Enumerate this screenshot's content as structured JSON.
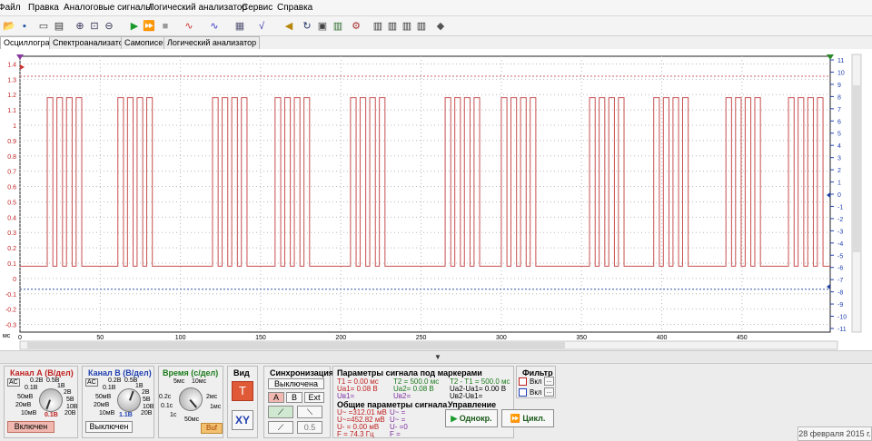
{
  "menu": [
    "Файл",
    "Правка",
    "Аналоговые сигналы",
    "Логический анализатор",
    "Сервис",
    "Справка"
  ],
  "tabs": [
    "Осциллограф",
    "Спектроанализатор",
    "Самописец",
    "Логический анализатор"
  ],
  "toolbar_icons": [
    "open-icon",
    "save-icon",
    "preview-icon",
    "print-icon",
    "zoom-in-icon",
    "zoom-fit-icon",
    "zoom-out-icon",
    "play-icon",
    "play-fast-icon",
    "stop-icon",
    "signal-add-icon",
    "signal-sub-icon",
    "memory-icon",
    "math-icon",
    "volume-icon",
    "refresh-icon",
    "image-icon",
    "calc-icon",
    "settings-icon",
    "marker-icon",
    "logic1-icon",
    "logic2-icon",
    "logic3-icon",
    "logic4-icon",
    "logic5-icon",
    "eraser-icon"
  ],
  "chart_data": {
    "type": "line",
    "x_unit": "мс",
    "x_ticks": [
      0,
      50,
      100,
      150,
      200,
      250,
      300,
      350,
      400,
      450
    ],
    "y_left_ticks": [
      1.4,
      1.3,
      1.2,
      1.1,
      1,
      0.9,
      0.8,
      0.7,
      0.6,
      0.5,
      0.4,
      0.3,
      0.2,
      0.1,
      0,
      -0.1,
      -0.2,
      -0.3
    ],
    "y_right_ticks": [
      11,
      10,
      9,
      8,
      7,
      6,
      5,
      4,
      3,
      2,
      1,
      0,
      -1,
      -2,
      -3,
      -4,
      -5,
      -6,
      -7,
      -8,
      -9,
      -10,
      -11
    ],
    "xlim": [
      0,
      505
    ],
    "ylim": [
      -0.35,
      1.45
    ],
    "low_level": 0.08,
    "high_level": 1.18,
    "dashed_levels": [
      1.32,
      -0.07
    ],
    "bursts_start_ms": [
      17,
      61,
      120,
      159,
      206,
      265,
      300,
      355,
      395,
      440,
      479
    ],
    "burst_pulses": [
      [
        0,
        3.5
      ],
      [
        6,
        9.5
      ],
      [
        12,
        15.5
      ],
      [
        18,
        21.5
      ]
    ],
    "color": "#c85050"
  },
  "channel_a": {
    "title": "Канал А (В/дел)",
    "scale": [
      "0.2В",
      "0.5В",
      "1В",
      "2В",
      "0.1В",
      "5В",
      "50мВ",
      "10В",
      "20мВ",
      "20В",
      "10мВ"
    ],
    "value": "0.1В",
    "button": "Включен"
  },
  "channel_b": {
    "title": "Канал В (В/дел)",
    "scale": [
      "0.2В",
      "0.5В",
      "1В",
      "2В",
      "0.1В",
      "5В",
      "50мВ",
      "10В",
      "20мВ",
      "20В",
      "10мВ"
    ],
    "value": "1.1В",
    "button": "Выключен"
  },
  "time": {
    "title": "Время (с/дел)",
    "scale": [
      "5мс",
      "10мс",
      "0.2с",
      "2мс",
      "0.1с",
      "1мс",
      "1с",
      "50мс"
    ],
    "buf": "Buf"
  },
  "view": {
    "title": "Вид",
    "t": "T",
    "xy": "XY"
  },
  "sync": {
    "title": "Синхронизация",
    "mode": "Выключена",
    "a": "A",
    "b": "B",
    "ext": "Ext",
    "level": "0.5"
  },
  "markers": {
    "title": "Параметры сигнала под маркерами",
    "t1": "T1 = 0.00 мс",
    "t2": "T2 = 500.0 мс",
    "dt": "T2 - T1 = 500.0 мс",
    "ua1": "Uа1= 0.08 В",
    "ua2": "Uа2= 0.08 В",
    "dua": "Uа2-Uа1= 0.00 В",
    "ub1": "Uв1=",
    "ub2": "Uв2=",
    "dub": "Uв2-Uв1="
  },
  "general": {
    "title": "Общие параметры сигнала",
    "l1": "U~ =312.01 мВ",
    "l2": "U~=452.82 мВ",
    "l3": "U- = 0.00 мВ",
    "l4": "F = 74.3 Гц",
    "r1": "U~ =",
    "r2": "U~ =",
    "r3": "U- =0",
    "r4": "F ="
  },
  "control": {
    "title": "Управление",
    "single": "Однокр.",
    "cycle": "Цикл."
  },
  "filter": {
    "title": "Фильтр",
    "on": "Вкл",
    "dots": "..."
  },
  "date": "28 февраля 2015 г."
}
